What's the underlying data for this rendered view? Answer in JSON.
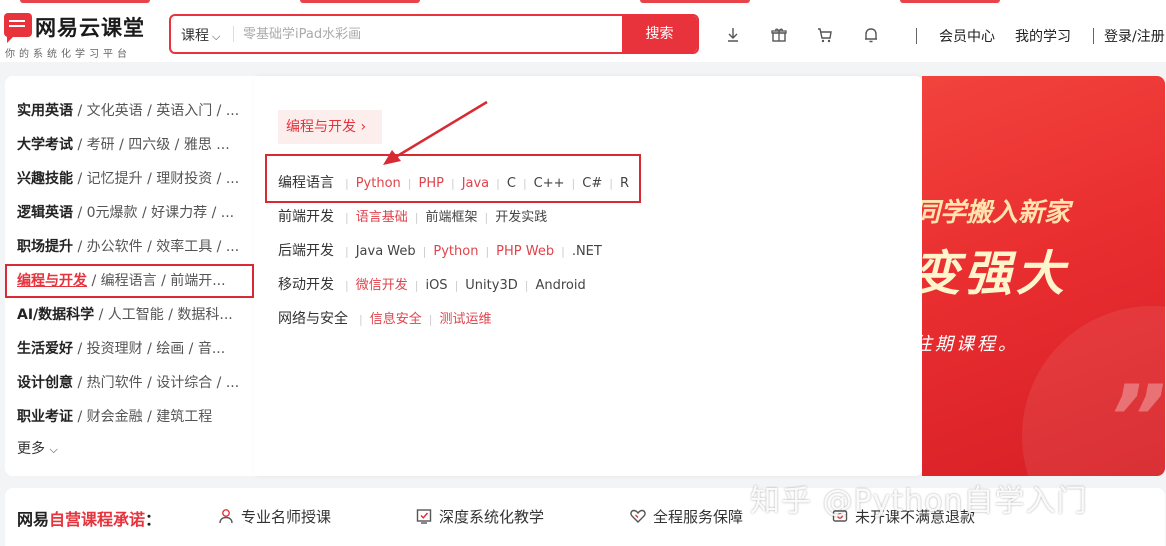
{
  "header": {
    "logo_title": "网易云课堂",
    "logo_sub": "你的系统化学习平台",
    "search_category": "课程",
    "search_placeholder": "零基础学iPad水彩画",
    "search_button": "搜索",
    "icons": [
      "download-icon",
      "gift-icon",
      "cart-icon",
      "bell-icon"
    ],
    "links": [
      "会员中心",
      "我的学习",
      "登录/注册"
    ]
  },
  "categories": [
    {
      "name": "实用英语",
      "subs": "/ 文化英语 / 英语入门 / ..."
    },
    {
      "name": "大学考试",
      "subs": "/ 考研 / 四六级 / 雅思 ..."
    },
    {
      "name": "兴趣技能",
      "subs": "/ 记忆提升 / 理财投资 / ..."
    },
    {
      "name": "逻辑英语",
      "subs": "/ 0元爆款 / 好课力荐 / ..."
    },
    {
      "name": "职场提升",
      "subs": "/ 办公软件 / 效率工具 / ..."
    },
    {
      "name": "编程与开发",
      "subs": "/ 编程语言 / 前端开..."
    },
    {
      "name": "AI/数据科学",
      "subs": "/ 人工智能 / 数据科..."
    },
    {
      "name": "生活爱好",
      "subs": "/ 投资理财 / 绘画 / 音..."
    },
    {
      "name": "设计创意",
      "subs": "/ 热门软件 / 设计综合 / ..."
    },
    {
      "name": "职业考证",
      "subs": "/ 财会金融 / 建筑工程"
    }
  ],
  "more_label": "更多",
  "submenu": {
    "tag": "编程与开发 ›",
    "rows": [
      {
        "title": "编程语言",
        "items": [
          {
            "label": "Python",
            "hot": true
          },
          {
            "label": "PHP",
            "hot": true
          },
          {
            "label": "Java",
            "hot": true
          },
          {
            "label": "C",
            "hot": false
          },
          {
            "label": "C++",
            "hot": false
          },
          {
            "label": "C#",
            "hot": false
          },
          {
            "label": "R",
            "hot": false
          }
        ]
      },
      {
        "title": "前端开发",
        "items": [
          {
            "label": "语言基础",
            "hot": true
          },
          {
            "label": "前端框架",
            "hot": false
          },
          {
            "label": "开发实践",
            "hot": false
          }
        ]
      },
      {
        "title": "后端开发",
        "items": [
          {
            "label": "Java Web",
            "hot": false
          },
          {
            "label": "Python",
            "hot": true
          },
          {
            "label": "PHP Web",
            "hot": true
          },
          {
            "label": ".NET",
            "hot": false
          }
        ]
      },
      {
        "title": "移动开发",
        "items": [
          {
            "label": "微信开发",
            "hot": true
          },
          {
            "label": "iOS",
            "hot": false
          },
          {
            "label": "Unity3D",
            "hot": false
          },
          {
            "label": "Android",
            "hot": false
          }
        ]
      },
      {
        "title": "网络与安全",
        "items": [
          {
            "label": "信息安全",
            "hot": true
          },
          {
            "label": "测试运维",
            "hot": true
          }
        ]
      }
    ]
  },
  "banner": {
    "line1": "同学搬入新家",
    "line2": "变强大",
    "line3": "往期课程。"
  },
  "promise": {
    "title_a": "网易",
    "title_b": "自营课程承诺",
    "title_c": "：",
    "items": [
      "专业名师授课",
      "深度系统化教学",
      "全程服务保障",
      "未开课不满意退款"
    ]
  },
  "watermark": "知乎 @Python自学入门",
  "colors": {
    "accent": "#e8323c"
  }
}
